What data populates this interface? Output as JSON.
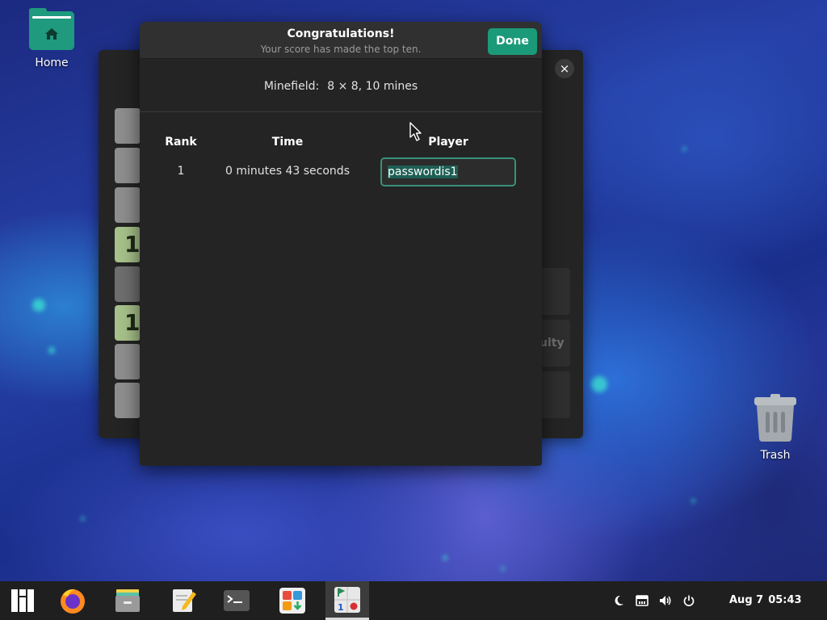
{
  "desktop": {
    "icons": [
      {
        "label": "Home",
        "icon": "home-folder-icon"
      },
      {
        "label": "Trash",
        "icon": "trash-icon"
      }
    ]
  },
  "background_window": {
    "app": "Mines",
    "close_glyph": "×",
    "visible_tile_numbers": [
      "1",
      "1"
    ],
    "partial_side_text": "ulty"
  },
  "dialog": {
    "title": "Congratulations!",
    "subtitle": "Your score has made the top ten.",
    "done_label": "Done",
    "minefield_label": "Minefield:",
    "minefield_value": "8 × 8, 10 mines",
    "columns": [
      "Rank",
      "Time",
      "Player"
    ],
    "rows": [
      {
        "rank": "1",
        "time": "0 minutes 43 seconds",
        "player": "passwordis1"
      }
    ]
  },
  "taskbar": {
    "apps": [
      "app-menu",
      "firefox",
      "file-manager",
      "text-editor",
      "terminal",
      "software",
      "mines"
    ],
    "active_app": "mines",
    "tray": [
      "night-light-icon",
      "network-icon",
      "volume-icon",
      "power-icon"
    ],
    "date": "Aug 7",
    "time": "05:43"
  },
  "colors": {
    "accent": "#1b9a7a",
    "dialog_bg": "#242424",
    "taskbar_bg": "#1f1f1f"
  }
}
